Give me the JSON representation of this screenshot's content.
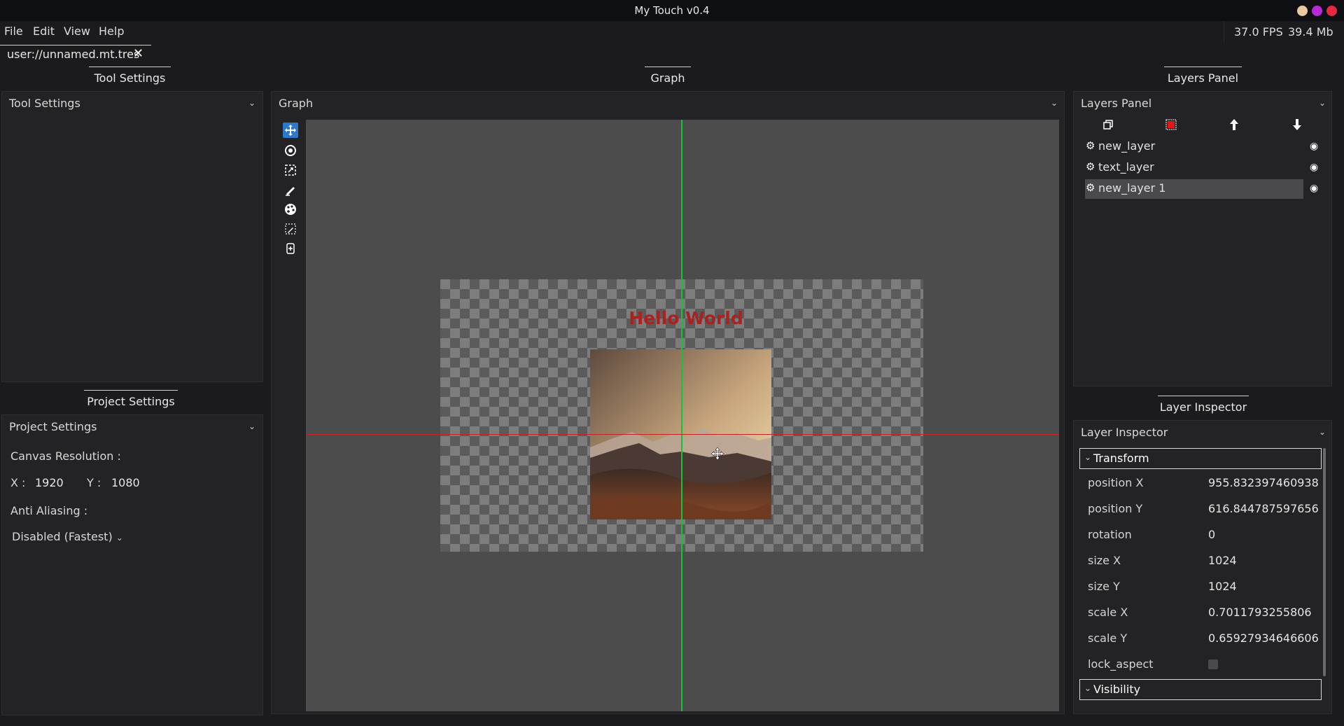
{
  "window": {
    "title": "My Touch v0.4"
  },
  "menu": {
    "file": "File",
    "edit": "Edit",
    "view": "View",
    "help": "Help"
  },
  "stats": {
    "fps": "37.0 FPS",
    "memory": "39.4 Mb"
  },
  "file_tab": {
    "label": "user://unnamed.mt.tres",
    "close": "✕"
  },
  "tool_settings": {
    "tab": "Tool Settings",
    "header": "Tool Settings"
  },
  "project_settings": {
    "tab": "Project Settings",
    "header": "Project Settings",
    "canvas_resolution_label": "Canvas Resolution :",
    "x_label": "X :",
    "x_value": "1920",
    "y_label": "Y :",
    "y_value": "1080",
    "anti_aliasing_label": "Anti Aliasing :",
    "anti_aliasing_value": "Disabled (Fastest)"
  },
  "graph": {
    "tab": "Graph",
    "header": "Graph",
    "canvas_text": "Hello World"
  },
  "tools": [
    {
      "icon": "move-icon",
      "active": true
    },
    {
      "icon": "rotate-icon",
      "active": false
    },
    {
      "icon": "scale-icon",
      "active": false
    },
    {
      "icon": "brush-icon",
      "active": false
    },
    {
      "icon": "palette-icon",
      "active": false
    },
    {
      "icon": "eyedropper-icon",
      "active": false
    },
    {
      "icon": "add-layer-tool-icon",
      "active": false
    }
  ],
  "layers_panel": {
    "tab": "Layers Panel",
    "header": "Layers Panel",
    "toolbar": [
      "duplicate-icon",
      "delete-icon",
      "move-up-icon",
      "move-down-icon"
    ],
    "layers": [
      {
        "name": "new_layer",
        "selected": false
      },
      {
        "name": "text_layer",
        "selected": false
      },
      {
        "name": "new_layer 1",
        "selected": true
      }
    ]
  },
  "layer_inspector": {
    "tab": "Layer Inspector",
    "header": "Layer Inspector",
    "transform_group": "Transform",
    "visibility_group": "Visibility",
    "properties": [
      {
        "label": "position X",
        "value": "955.832397460938"
      },
      {
        "label": "position Y",
        "value": "616.844787597656"
      },
      {
        "label": "rotation",
        "value": "0"
      },
      {
        "label": "size X",
        "value": "1024"
      },
      {
        "label": "size Y",
        "value": "1024"
      },
      {
        "label": "scale X",
        "value": "0.7011793255806"
      },
      {
        "label": "scale Y",
        "value": "0.65927934646606"
      },
      {
        "label": "lock_aspect",
        "value": ""
      }
    ]
  },
  "colors": {
    "accent": "#2c79c9",
    "guide_vertical": "#16c23a",
    "guide_horizontal": "#c02424",
    "canvas_text": "#a82222",
    "delete_layer": "#e01818"
  }
}
